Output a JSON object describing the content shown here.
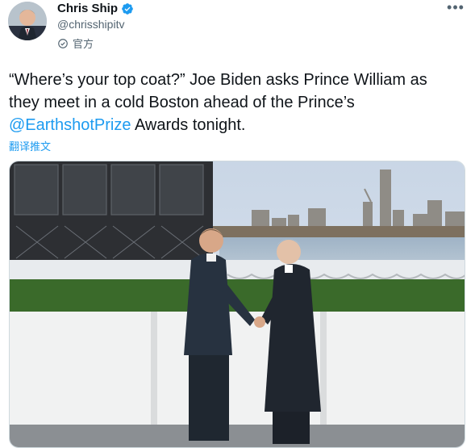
{
  "tweet": {
    "author": {
      "display_name": "Chris Ship",
      "handle": "@chrisshipitv",
      "verified": true,
      "label": "官方",
      "avatar_icon": "avatar-photo"
    },
    "more_icon": "more-horizontal-icon",
    "text": {
      "before": "“Where’s your top coat?” Joe Biden asks Prince William as they meet in a cold Boston ahead of the Prince’s ",
      "mention": "@EarthshotPrize",
      "after": " Awards tonight."
    },
    "translate_label": "翻译推文",
    "media": {
      "type": "photo",
      "description_icon": "tweet-photo"
    }
  },
  "colors": {
    "accent": "#1d9bf0",
    "text": "#0f1419",
    "secondary": "#536471",
    "border": "#cfd9de"
  }
}
